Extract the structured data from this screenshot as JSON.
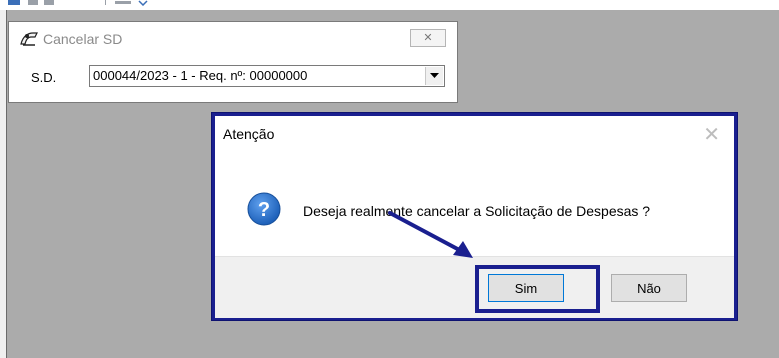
{
  "sd_window": {
    "title": "Cancelar SD",
    "close_glyph": "✕",
    "field_label": "S.D.",
    "select_value": "000044/2023 - 1  - Req. nº: 00000000"
  },
  "dialog": {
    "title": "Atenção",
    "close_glyph": "✕",
    "message": "Deseja realmente cancelar a Solicitação de Despesas ?",
    "icon": "question-icon",
    "yes_label": "Sim",
    "no_label": "Não"
  },
  "colors": {
    "highlight": "#1a1f8f",
    "workspace": "#ababab",
    "question_blue": "#1c5fb8"
  }
}
